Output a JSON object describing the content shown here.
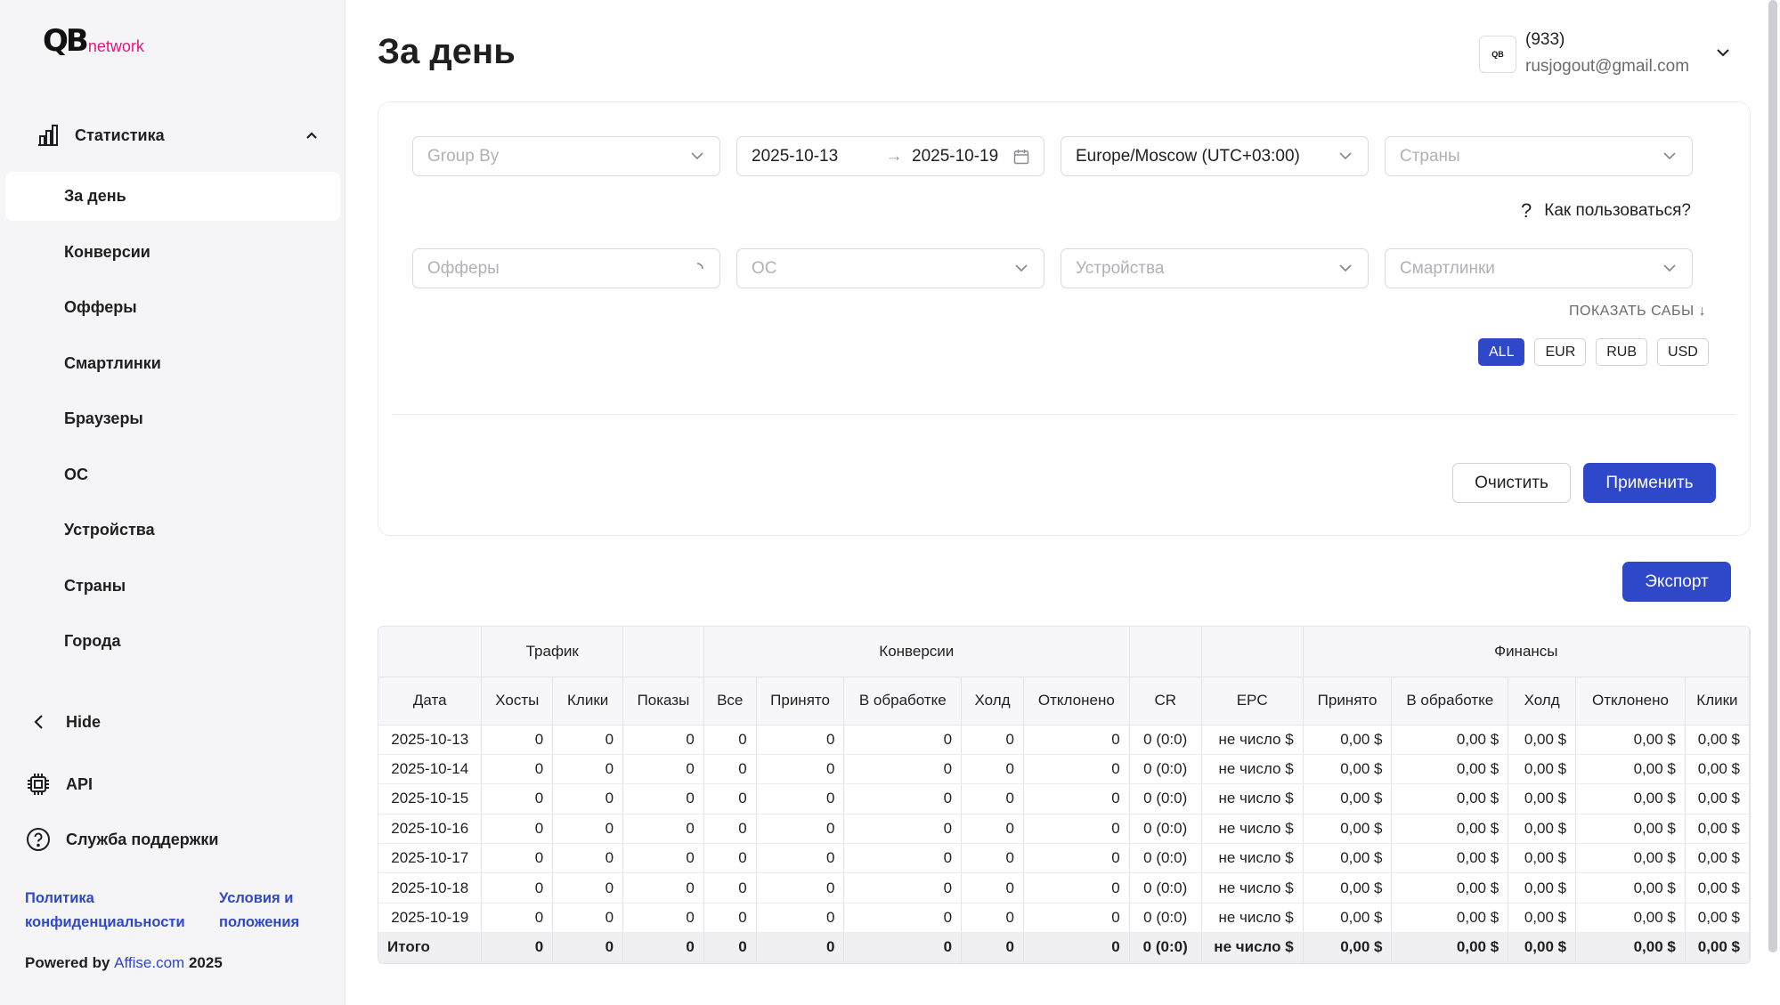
{
  "brand": {
    "mark": "QB",
    "word": "network"
  },
  "sidebar": {
    "section_label": "Статистика",
    "items": [
      {
        "label": "За день",
        "active": true
      },
      {
        "label": "Конверсии"
      },
      {
        "label": "Офферы"
      },
      {
        "label": "Смартлинки"
      },
      {
        "label": "Браузеры"
      },
      {
        "label": "ОС"
      },
      {
        "label": "Устройства"
      },
      {
        "label": "Страны"
      },
      {
        "label": "Города"
      }
    ],
    "hide_label": "Hide",
    "api_label": "API",
    "support_label": "Служба поддержки",
    "privacy_label": "Политика конфиденциальности",
    "terms_label": "Условия и положения",
    "powered_prefix": "Powered by",
    "powered_link": "Affise.com",
    "powered_year": "2025"
  },
  "header": {
    "title": "За день",
    "user_id": "(933)",
    "user_email": "rusjogout@gmail.com"
  },
  "filters": {
    "group_by_placeholder": "Group By",
    "date_from": "2025-10-13",
    "date_to": "2025-10-19",
    "date_arrow": "→",
    "timezone": "Europe/Moscow (UTC+03:00)",
    "countries_placeholder": "Страны",
    "how_to": "Как пользоваться?",
    "offers_placeholder": "Офферы",
    "os_placeholder": "ОС",
    "devices_placeholder": "Устройства",
    "smartlinks_placeholder": "Смартлинки",
    "show_subs": "ПОКАЗАТЬ САБЫ",
    "currencies": [
      "ALL",
      "EUR",
      "RUB",
      "USD"
    ],
    "active_currency": "ALL",
    "clear_label": "Очистить",
    "apply_label": "Применить"
  },
  "export_label": "Экспорт",
  "table": {
    "groups": {
      "traffic": "Трафик",
      "conversions": "Конверсии",
      "finance": "Финансы"
    },
    "columns": [
      "Дата",
      "Хосты",
      "Клики",
      "Показы",
      "Все",
      "Принято",
      "В обработке",
      "Холд",
      "Отклонено",
      "CR",
      "EPC",
      "Принято",
      "В обработке",
      "Холд",
      "Отклонено",
      "Клики"
    ],
    "rows": [
      [
        "2025-10-13",
        "0",
        "0",
        "0",
        "0",
        "0",
        "0",
        "0",
        "0",
        "0 (0:0)",
        "не число $",
        "0,00 $",
        "0,00 $",
        "0,00 $",
        "0,00 $",
        "0,00 $"
      ],
      [
        "2025-10-14",
        "0",
        "0",
        "0",
        "0",
        "0",
        "0",
        "0",
        "0",
        "0 (0:0)",
        "не число $",
        "0,00 $",
        "0,00 $",
        "0,00 $",
        "0,00 $",
        "0,00 $"
      ],
      [
        "2025-10-15",
        "0",
        "0",
        "0",
        "0",
        "0",
        "0",
        "0",
        "0",
        "0 (0:0)",
        "не число $",
        "0,00 $",
        "0,00 $",
        "0,00 $",
        "0,00 $",
        "0,00 $"
      ],
      [
        "2025-10-16",
        "0",
        "0",
        "0",
        "0",
        "0",
        "0",
        "0",
        "0",
        "0 (0:0)",
        "не число $",
        "0,00 $",
        "0,00 $",
        "0,00 $",
        "0,00 $",
        "0,00 $"
      ],
      [
        "2025-10-17",
        "0",
        "0",
        "0",
        "0",
        "0",
        "0",
        "0",
        "0",
        "0 (0:0)",
        "не число $",
        "0,00 $",
        "0,00 $",
        "0,00 $",
        "0,00 $",
        "0,00 $"
      ],
      [
        "2025-10-18",
        "0",
        "0",
        "0",
        "0",
        "0",
        "0",
        "0",
        "0",
        "0 (0:0)",
        "не число $",
        "0,00 $",
        "0,00 $",
        "0,00 $",
        "0,00 $",
        "0,00 $"
      ],
      [
        "2025-10-19",
        "0",
        "0",
        "0",
        "0",
        "0",
        "0",
        "0",
        "0",
        "0 (0:0)",
        "не число $",
        "0,00 $",
        "0,00 $",
        "0,00 $",
        "0,00 $",
        "0,00 $"
      ]
    ],
    "total": [
      "Итого",
      "0",
      "0",
      "0",
      "0",
      "0",
      "0",
      "0",
      "0",
      "0 (0:0)",
      "не число $",
      "0,00 $",
      "0,00 $",
      "0,00 $",
      "0,00 $",
      "0,00 $"
    ]
  },
  "colors": {
    "accent": "#2f47c9",
    "brand_pink": "#e0197d"
  }
}
